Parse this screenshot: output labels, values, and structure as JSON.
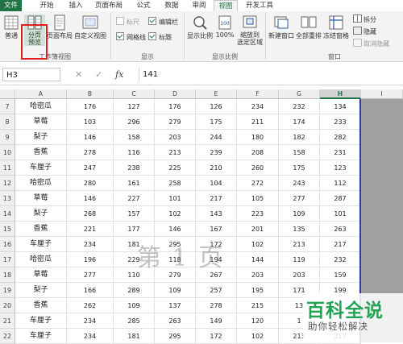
{
  "tabs": [
    "文件",
    "开始",
    "插入",
    "页面布局",
    "公式",
    "数据",
    "审阅",
    "视图",
    "开发工具"
  ],
  "ribbon": {
    "workbook_views": {
      "normal": "普通",
      "page_break": "分页\n预览",
      "page_layout": "页面布局",
      "custom": "自定义视图",
      "group_label": "工作簿视图"
    },
    "show": {
      "ruler": "标尺",
      "formula_bar": "编辑栏",
      "gridlines": "网格线",
      "headings": "标题",
      "group_label": "显示"
    },
    "zoom": {
      "zoom": "显示比例",
      "hundred": "100%",
      "zoom_selection": "缩放到\n选定区域",
      "group_label": "显示比例"
    },
    "window": {
      "new_window": "新建窗口",
      "arrange_all": "全部重排",
      "freeze_panes": "冻结窗格",
      "split": "拆分",
      "hide": "隐藏",
      "unhide": "取消隐藏",
      "group_label": "窗口"
    }
  },
  "formula_bar": {
    "name_box": "H3",
    "fx": "fx",
    "value": "141"
  },
  "columns": [
    "A",
    "B",
    "C",
    "D",
    "E",
    "F",
    "G",
    "H",
    "I"
  ],
  "selected_column": "H",
  "rows": [
    {
      "num": "7",
      "cells": [
        "哈密瓜",
        "176",
        "127",
        "176",
        "126",
        "234",
        "232",
        "134"
      ]
    },
    {
      "num": "8",
      "cells": [
        "草莓",
        "103",
        "296",
        "279",
        "175",
        "211",
        "174",
        "233"
      ]
    },
    {
      "num": "9",
      "cells": [
        "梨子",
        "146",
        "158",
        "203",
        "244",
        "180",
        "182",
        "282"
      ]
    },
    {
      "num": "10",
      "cells": [
        "香蕉",
        "278",
        "116",
        "213",
        "239",
        "208",
        "158",
        "231"
      ]
    },
    {
      "num": "11",
      "cells": [
        "车厘子",
        "247",
        "238",
        "225",
        "210",
        "260",
        "175",
        "123"
      ]
    },
    {
      "num": "12",
      "cells": [
        "哈密瓜",
        "280",
        "161",
        "258",
        "104",
        "272",
        "243",
        "112"
      ]
    },
    {
      "num": "13",
      "cells": [
        "草莓",
        "146",
        "227",
        "101",
        "217",
        "105",
        "277",
        "287"
      ]
    },
    {
      "num": "14",
      "cells": [
        "梨子",
        "268",
        "157",
        "102",
        "143",
        "223",
        "109",
        "101"
      ]
    },
    {
      "num": "15",
      "cells": [
        "香蕉",
        "221",
        "177",
        "146",
        "167",
        "201",
        "135",
        "263"
      ]
    },
    {
      "num": "16",
      "cells": [
        "车厘子",
        "234",
        "181",
        "295",
        "172",
        "102",
        "213",
        "217"
      ]
    },
    {
      "num": "17",
      "cells": [
        "哈密瓜",
        "196",
        "229",
        "118",
        "194",
        "144",
        "119",
        "232"
      ]
    },
    {
      "num": "18",
      "cells": [
        "草莓",
        "277",
        "110",
        "279",
        "267",
        "203",
        "203",
        "159"
      ]
    },
    {
      "num": "19",
      "cells": [
        "梨子",
        "166",
        "289",
        "109",
        "257",
        "195",
        "171",
        "199"
      ]
    },
    {
      "num": "20",
      "cells": [
        "香蕉",
        "262",
        "109",
        "137",
        "278",
        "215",
        "13",
        ""
      ]
    },
    {
      "num": "21",
      "cells": [
        "车厘子",
        "234",
        "285",
        "263",
        "149",
        "120",
        "1",
        ""
      ]
    },
    {
      "num": "22",
      "cells": [
        "车厘子",
        "234",
        "181",
        "295",
        "172",
        "102",
        "213",
        "217"
      ]
    }
  ],
  "watermark": "第 1 页",
  "brand": {
    "title": "百科全说",
    "subtitle": "助你轻松解决"
  },
  "colors": {
    "accent": "#217346",
    "highlight": "#e0201e",
    "page_break_line": "#2b3aa8",
    "brand": "#23a455"
  }
}
